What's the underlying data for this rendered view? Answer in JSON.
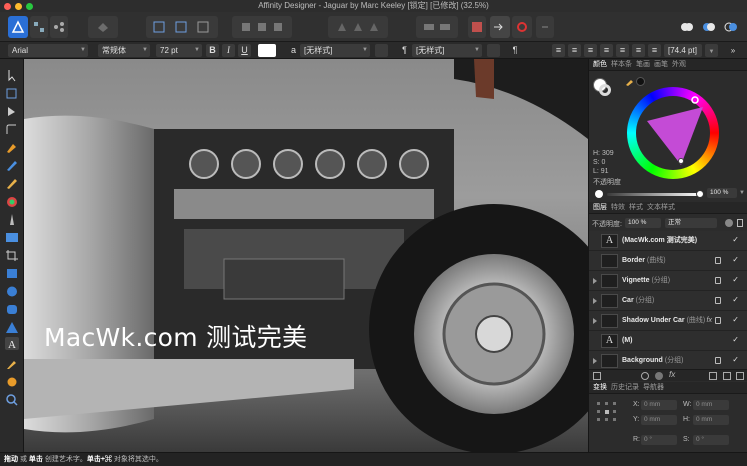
{
  "window": {
    "title": "Affinity Designer - Jaguar by Marc Keeley [锁定] [已修改] (32.5%)",
    "traffic_colors": [
      "#fe5f57",
      "#febc2e",
      "#28c840"
    ]
  },
  "toolbar": {
    "buttons": [
      "persona-designer-icon",
      "persona-pixel-icon",
      "persona-export-icon",
      "snapping-icon",
      "view-mode-1-icon",
      "view-mode-2-icon",
      "view-mode-3-icon",
      "order-icon",
      "align-icon",
      "transform-icon",
      "geometry-icon",
      "insert-icon",
      "snapping-toggle-icon",
      "color-picker-icon",
      "boolean-add-icon",
      "boolean-subtract-icon",
      "boolean-intersect-icon"
    ]
  },
  "context_toolbar": {
    "font_family": "Arial",
    "font_style": "常规体",
    "font_size": "72 pt",
    "bold": "B",
    "italic": "I",
    "underline": "U",
    "char_style_prefix": "a",
    "char_style": "[无样式]",
    "para_style_prefix": "¶",
    "para_style": "[无样式]",
    "leading": "[74.4 pt]"
  },
  "tools": [
    "move-tool-icon",
    "node-tool-icon",
    "point-transform-icon",
    "corner-tool-icon",
    "pen-tool-icon",
    "pencil-tool-icon",
    "vector-brush-icon",
    "fill-tool-icon",
    "transparency-tool-icon",
    "place-image-icon",
    "crop-tool-icon",
    "rectangle-tool-icon",
    "ellipse-tool-icon",
    "rounded-rect-icon",
    "triangle-tool-icon",
    "artistic-text-icon",
    "color-picker-icon",
    "hand-tool-icon",
    "zoom-tool-icon"
  ],
  "canvas": {
    "watermark": "MacWk.com 测试完美"
  },
  "status": {
    "part1_bold": "拖动",
    "part2": " 或 ",
    "part3_bold": "单击",
    "part4": " 创建艺术字。",
    "part5_bold": "单击+⌘",
    "part6": " 对象将其选中。"
  },
  "color_panel": {
    "tabs": [
      "颜色",
      "样本条",
      "笔画",
      "画笔",
      "外观"
    ],
    "h": "H: 309",
    "s": "S: 0",
    "l": "L: 91",
    "opacity_label": "不透明度",
    "opacity_value": "100 %",
    "fill_color": "#b044c4"
  },
  "layers_panel": {
    "tabs": [
      "图层",
      "特效",
      "样式",
      "文本样式"
    ],
    "opacity_label": "不透明度:",
    "opacity_value": "100 %",
    "blend_mode": "正常",
    "rows": [
      {
        "thumb": "A",
        "name": "(MacWk.com 测试完美)",
        "type": "",
        "lock": false,
        "fx": false,
        "expand": false
      },
      {
        "thumb": "",
        "name": "Border",
        "type": " (曲线)",
        "lock": true,
        "fx": false,
        "expand": false
      },
      {
        "thumb": "",
        "name": "Vignette",
        "type": " (分组)",
        "lock": true,
        "fx": false,
        "expand": true
      },
      {
        "thumb": "",
        "name": "Car",
        "type": " (分组)",
        "lock": true,
        "fx": false,
        "expand": true
      },
      {
        "thumb": "",
        "name": "Shadow Under Car",
        "type": " (曲线)",
        "lock": true,
        "fx": true,
        "expand": true
      },
      {
        "thumb": "A",
        "name": "(M)",
        "type": "",
        "lock": false,
        "fx": false,
        "expand": false
      },
      {
        "thumb": "",
        "name": "Background",
        "type": " (分组)",
        "lock": true,
        "fx": false,
        "expand": true
      }
    ],
    "fx_label": "fx",
    "check": "✓"
  },
  "transform_panel": {
    "tabs": [
      "变换",
      "历史记录",
      "导航器"
    ],
    "x_label": "X:",
    "x_value": "0 mm",
    "y_label": "Y:",
    "y_value": "0 mm",
    "w_label": "W:",
    "w_value": "0 mm",
    "h_label": "H:",
    "h_value": "0 mm",
    "r_label": "R:",
    "r_value": "0 °",
    "s_label": "S:",
    "s_value": "0 °"
  }
}
